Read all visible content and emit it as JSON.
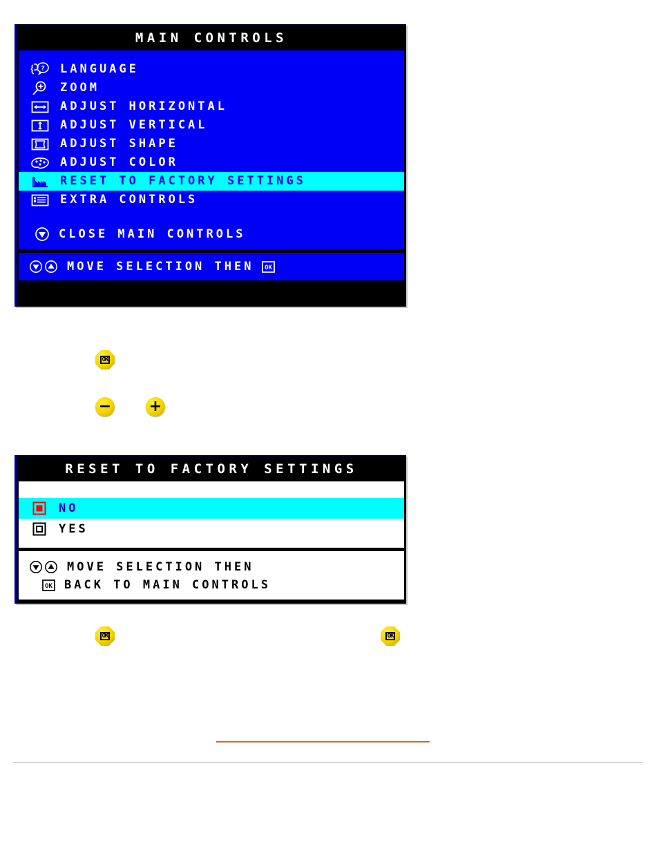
{
  "main_panel": {
    "title": "MAIN CONTROLS",
    "items": [
      {
        "icon": "language-icon",
        "label": "LANGUAGE",
        "selected": false
      },
      {
        "icon": "zoom-icon",
        "label": "ZOOM",
        "selected": false
      },
      {
        "icon": "adjust-horizontal-icon",
        "label": "ADJUST HORIZONTAL",
        "selected": false
      },
      {
        "icon": "adjust-vertical-icon",
        "label": "ADJUST VERTICAL",
        "selected": false
      },
      {
        "icon": "adjust-shape-icon",
        "label": "ADJUST SHAPE",
        "selected": false
      },
      {
        "icon": "adjust-color-icon",
        "label": "ADJUST COLOR",
        "selected": false
      },
      {
        "icon": "factory-reset-icon",
        "label": "RESET TO FACTORY SETTINGS",
        "selected": true
      },
      {
        "icon": "extra-controls-icon",
        "label": "EXTRA CONTROLS",
        "selected": false
      }
    ],
    "close_item": {
      "icon": "arrow-down-circle-icon",
      "label": "CLOSE MAIN CONTROLS"
    },
    "footer": {
      "icons": [
        "arrow-down-circle-icon",
        "arrow-up-circle-icon"
      ],
      "text": "MOVE SELECTION THEN",
      "trailing_icon": "ok-key-icon"
    }
  },
  "reset_panel": {
    "title": "RESET TO FACTORY SETTINGS",
    "options": [
      {
        "icon": "radio-selected-icon",
        "label": "NO",
        "selected": true
      },
      {
        "icon": "radio-unselected-icon",
        "label": "YES",
        "selected": false
      }
    ],
    "footer_line_1": {
      "icons": [
        "arrow-down-circle-icon",
        "arrow-up-circle-icon"
      ],
      "text": "MOVE SELECTION THEN"
    },
    "footer_line_2": {
      "icon": "ok-key-icon",
      "text": "BACK TO MAIN CONTROLS"
    }
  },
  "buttons": [
    {
      "name": "ok-button-1",
      "type": "ok",
      "glyph": "OK"
    },
    {
      "name": "minus-button",
      "type": "minus",
      "glyph": "−"
    },
    {
      "name": "plus-button",
      "type": "plus",
      "glyph": "+"
    },
    {
      "name": "ok-button-2",
      "type": "ok",
      "glyph": "OK"
    },
    {
      "name": "ok-button-3",
      "type": "ok",
      "glyph": "OK"
    }
  ],
  "colors": {
    "osd_blue": "#0000f4",
    "highlight_cyan": "#00ffff",
    "title_black": "#000000",
    "radio_red": "#ff0000",
    "button_yellow": "#f5d400",
    "orange_rule": "#e2620e",
    "gray_rule": "#b0b0b0"
  }
}
